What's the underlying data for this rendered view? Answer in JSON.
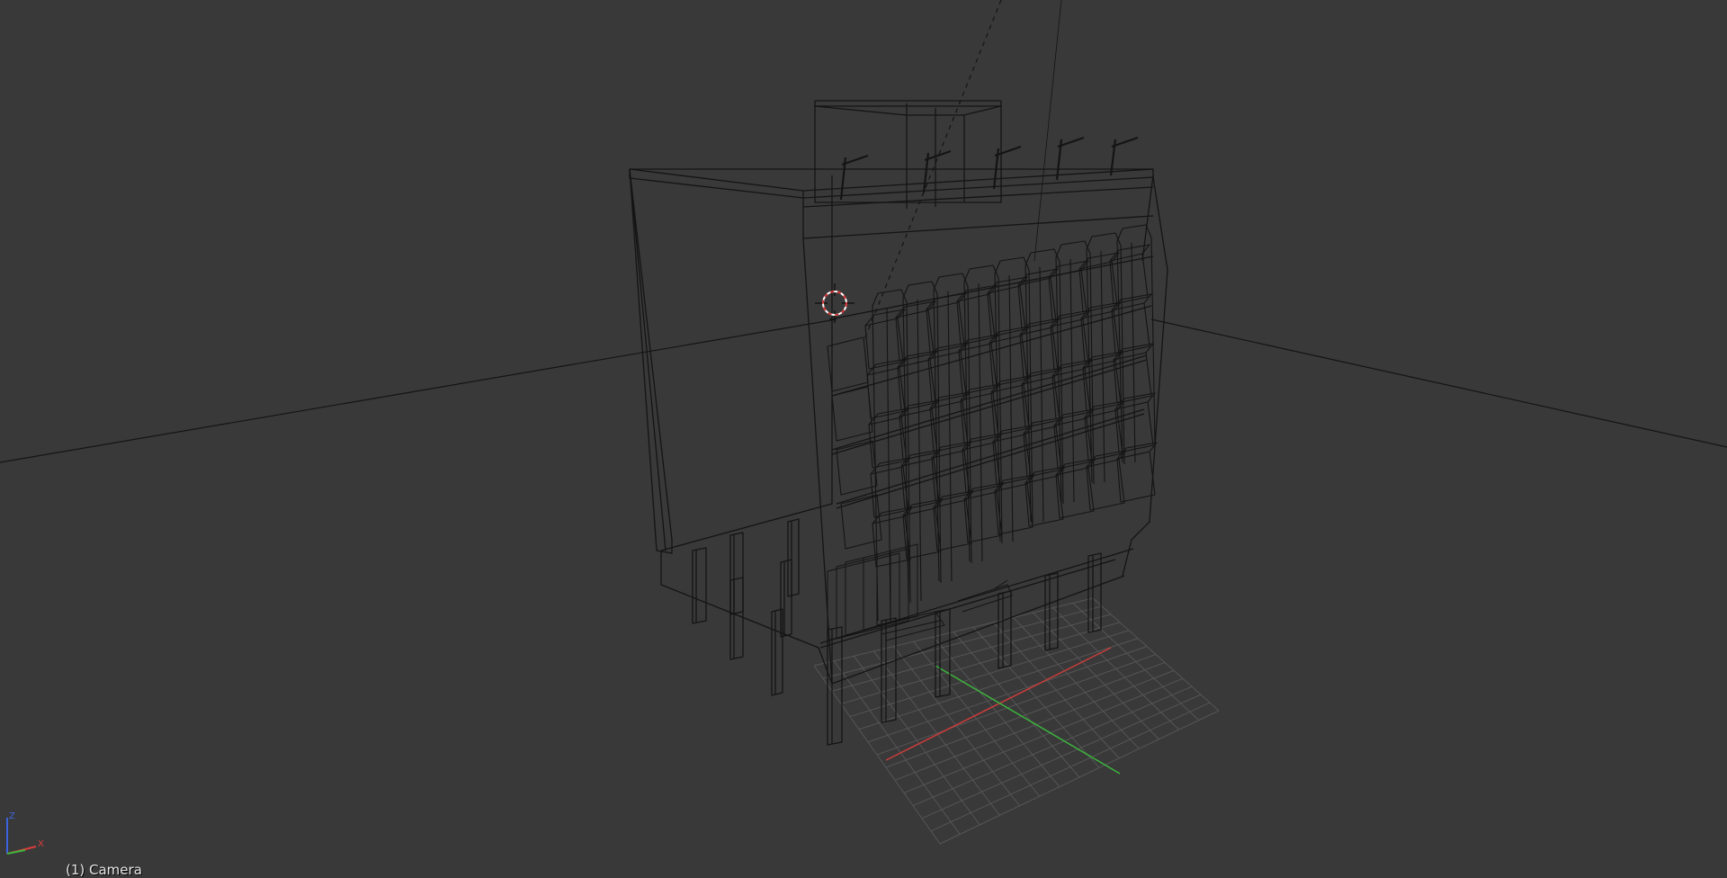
{
  "viewport": {
    "object_info": "(1) Camera",
    "view_mode": "wireframe",
    "background_color": "#393939",
    "wire_color": "#141414"
  },
  "gizmo": {
    "x_label": "X",
    "y_label": "Y",
    "z_label": "Z",
    "x_color": "#dc3c3c",
    "y_color": "#3cb43c",
    "z_color": "#3c64dc"
  },
  "grid": {
    "x_axis_color": "#c83c3c",
    "y_axis_color": "#3cb43c",
    "grid_line_color": "#555555"
  },
  "cursor_3d": {
    "color_a": "#ffffff",
    "color_b": "#d03030"
  }
}
